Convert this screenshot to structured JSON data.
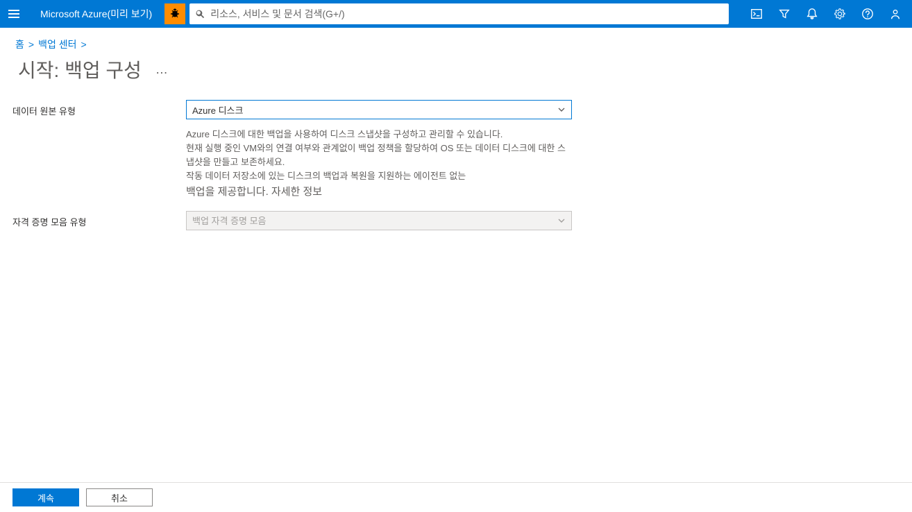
{
  "header": {
    "brand": "Microsoft Azure(미리 보기)",
    "search_placeholder": "리소스, 서비스 및 문서 검색(G+/)"
  },
  "breadcrumb": {
    "items": [
      "홈",
      "백업 센터"
    ]
  },
  "page": {
    "title": "시작: 백업 구성",
    "more": "…"
  },
  "form": {
    "datasource_label": "데이터 원본 유형",
    "datasource_value": "Azure 디스크",
    "desc_line1": "Azure 디스크에 대한 백업을 사용하여 디스크 스냅샷을 구성하고 관리할 수 있습니다.",
    "desc_line2": "현재 실행 중인 VM와의 연결 여부와 관계없이 백업 정책을 할당하여 OS 또는 데이터 디스크에 대한 스냅샷을 만들고 보존하세요.",
    "desc_line3": "작동 데이터 저장소에 있는 디스크의 백업과 복원을 지원하는 에이전트 없는",
    "desc_line4_part1": "백업을 제공합니다. ",
    "desc_line4_link": "자세한 정보",
    "vault_type_label": "자격 증명 모음 유형",
    "vault_type_value": "백업 자격 증명 모음"
  },
  "footer": {
    "continue_label": "계속",
    "cancel_label": "취소"
  }
}
